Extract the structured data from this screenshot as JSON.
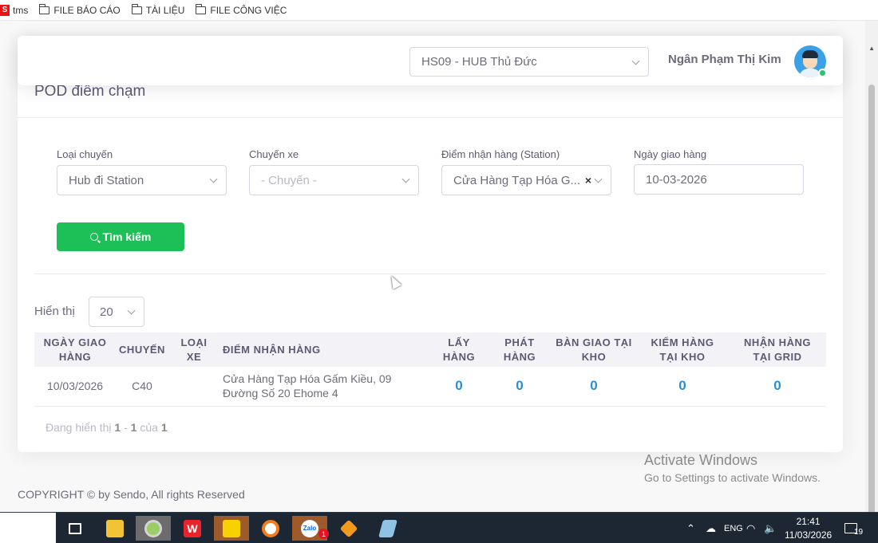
{
  "bookmarks": [
    {
      "label": "tms",
      "icon": "tms-logo-icon"
    },
    {
      "label": "FILE BÁO CÁO",
      "icon": "folder-icon"
    },
    {
      "label": "TÀI LIỆU",
      "icon": "folder-icon"
    },
    {
      "label": "FILE CÔNG VIỆC",
      "icon": "folder-icon"
    }
  ],
  "topnav": {
    "hub_value": "HS09 - HUB Thủ Đức",
    "user_name": "Ngân Phạm Thị Kim"
  },
  "page": {
    "title": "POD điểm chạm"
  },
  "filters": {
    "trip_type": {
      "label": "Loại chuyến",
      "value": "Hub đi Station"
    },
    "trip": {
      "label": "Chuyến xe",
      "placeholder": "- Chuyến -"
    },
    "station": {
      "label": "Điểm nhận hàng (Station)",
      "value": "Cửa Hàng Tạp Hóa G...",
      "clear": "×"
    },
    "date": {
      "label": "Ngày giao hàng",
      "value": "10-03-2026"
    },
    "search_label": "Tìm kiếm"
  },
  "table": {
    "show_label": "Hiển thị",
    "page_size": "20",
    "headers": {
      "date": [
        "NGÀY GIAO",
        "HÀNG"
      ],
      "trip": [
        "CHUYẾN"
      ],
      "vehicle": [
        "LOẠI",
        "XE"
      ],
      "point": [
        "ĐIỂM NHẬN HÀNG"
      ],
      "pickup": [
        "LẤY",
        "HÀNG"
      ],
      "deliver": [
        "PHÁT",
        "HÀNG"
      ],
      "handover": [
        "BÀN GIAO TẠI",
        "KHO"
      ],
      "check": [
        "KIỂM HÀNG",
        "TẠI KHO"
      ],
      "receive": [
        "NHẬN HÀNG",
        "TẠI GRID"
      ]
    },
    "rows": [
      {
        "date": "10/03/2026",
        "trip": "C40",
        "vehicle": "",
        "point": "Cửa Hàng Tạp Hóa Gấm Kiều, 09 Đường Số 20 Ehome 4",
        "pickup": "0",
        "deliver": "0",
        "handover": "0",
        "check": "0",
        "receive": "0"
      }
    ],
    "paging": {
      "prefix": "Đang hiển thị",
      "from": "1",
      "sep": " - ",
      "to": "1",
      "of": "của",
      "total": "1"
    }
  },
  "footer": {
    "copyright": "COPYRIGHT © by Sendo, All rights Reserved"
  },
  "watermark": {
    "title": "Activate Windows",
    "subtitle": "Go to Settings to activate Windows."
  },
  "taskbar": {
    "apps": [
      "task-view-icon",
      "file-explorer-icon",
      "chrome-icon",
      "wps-office-icon",
      "sticky-notes-icon",
      "app-circle-icon",
      "zalo-icon",
      "foxit-icon",
      "notepad-icon"
    ],
    "zalo_badge": "1",
    "tray_lang": "ENG",
    "time": "21:41",
    "date": "11/03/2026",
    "notification_count": "19"
  }
}
